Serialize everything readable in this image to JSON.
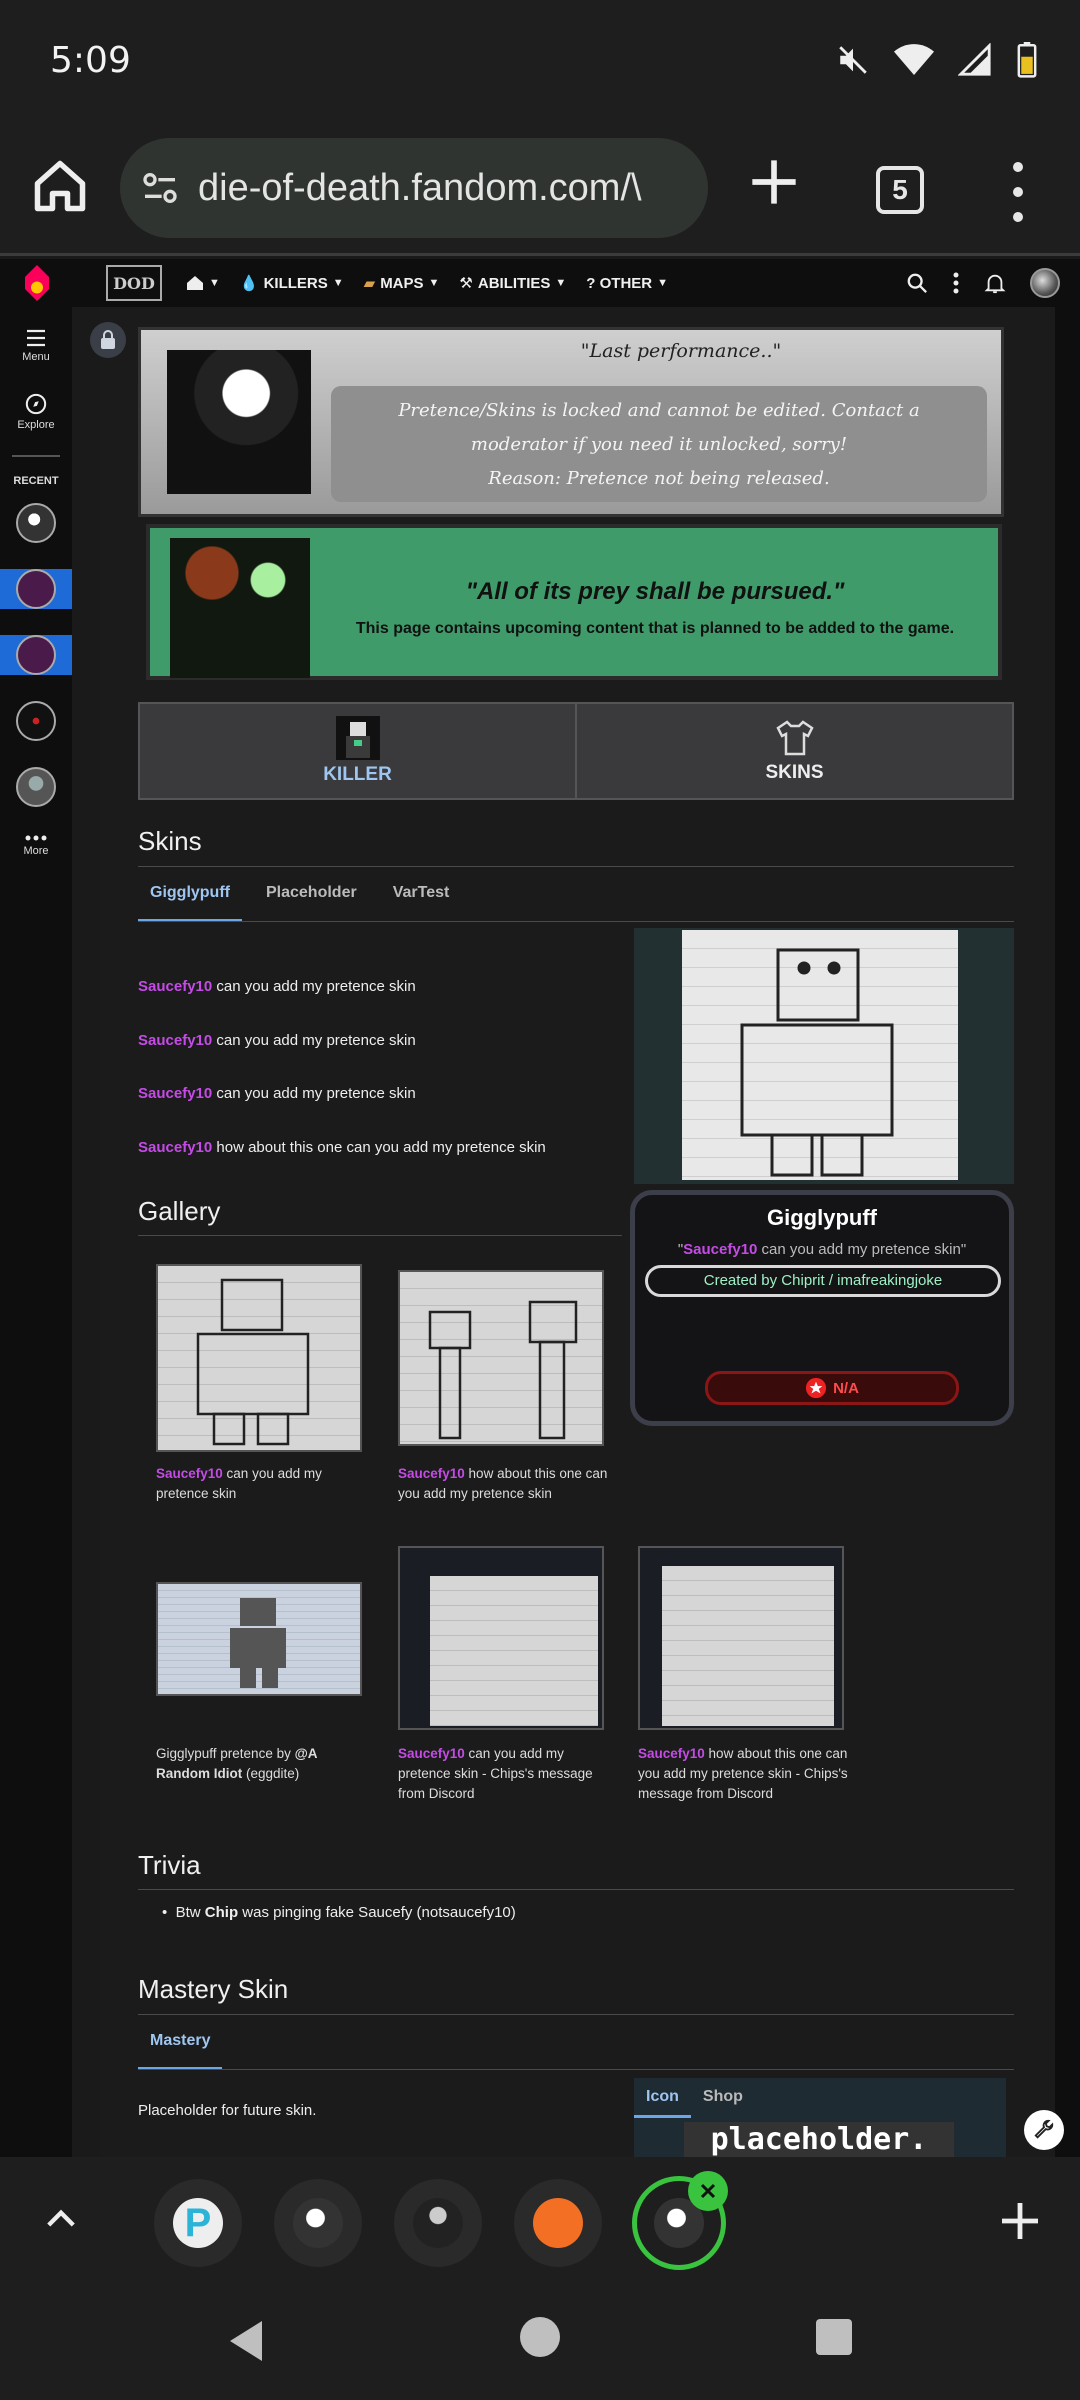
{
  "status": {
    "time": "5:09"
  },
  "browser": {
    "url": "die-of-death.fandom.com/\\",
    "tab_count": "5"
  },
  "nav": {
    "items": [
      {
        "label": "KILLERS"
      },
      {
        "label": "MAPS"
      },
      {
        "label": "ABILITIES"
      },
      {
        "label": "? OTHER"
      }
    ]
  },
  "rail": {
    "menu": "Menu",
    "explore": "Explore",
    "recent": "RECENT",
    "more": "More"
  },
  "notices": {
    "locked_quote": "\"Last performance..\"",
    "locked_line1": "Pretence/Skins is locked and cannot be edited. Contact a moderator if you need it unlocked, sorry!",
    "locked_line2": "Reason: Pretence not being released.",
    "upcoming_quote": "\"All of its prey shall be pursued.\"",
    "upcoming_text": "This page contains upcoming content that is planned to be added to the game."
  },
  "page_tabs": {
    "killer": "KILLER",
    "skins": "SKINS"
  },
  "skins": {
    "heading": "Skins",
    "tabs": [
      "Gigglypuff",
      "Placeholder",
      "VarTest"
    ],
    "lines": [
      {
        "user": "Saucefy10",
        "text": " can you add my pretence skin"
      },
      {
        "user": "Saucefy10",
        "text": " can you add my pretence skin"
      },
      {
        "user": "Saucefy10",
        "text": " can you add my pretence skin"
      },
      {
        "user": "Saucefy10",
        "text": " how about this one can you add my pretence skin"
      }
    ]
  },
  "infobox": {
    "name": "Gigglypuff",
    "quote_open": "\"",
    "quote_user": "Saucefy10",
    "quote_rest": " can you add my pretence skin\"",
    "credit": "Created by Chiprit / imafreakingjoke",
    "rating": "N/A"
  },
  "gallery": {
    "heading": "Gallery",
    "cap1_user": "Saucefy10",
    "cap1_rest": " can you add my pretence skin",
    "cap2_user": "Saucefy10",
    "cap2_rest": " how about this one can you add my pretence skin",
    "cap3_a": "Gigglypuff pretence by ",
    "cap3_b": "@A Random Idiot",
    "cap3_c": " (eggdite)",
    "cap4_user": "Saucefy10",
    "cap4_rest": " can you add my pretence skin - Chips's message from Discord",
    "cap5_user": "Saucefy10",
    "cap5_rest": " how about this one can you add my pretence skin - Chips's message from Discord"
  },
  "trivia": {
    "heading": "Trivia",
    "item_a": "Btw ",
    "item_b": "Chip",
    "item_c": " was pinging fake Saucefy (notsaucefy10)"
  },
  "mastery": {
    "heading": "Mastery Skin",
    "tab": "Mastery",
    "text": "Placeholder for future skin.",
    "box_tabs": [
      "Icon",
      "Shop"
    ],
    "banner": "placeholder."
  },
  "colors": {
    "accent_pink": "#c54be6",
    "tab_active": "#6aa6e8",
    "upcoming_green": "#3f9c6a",
    "active_tab_ring": "#39c33f"
  }
}
